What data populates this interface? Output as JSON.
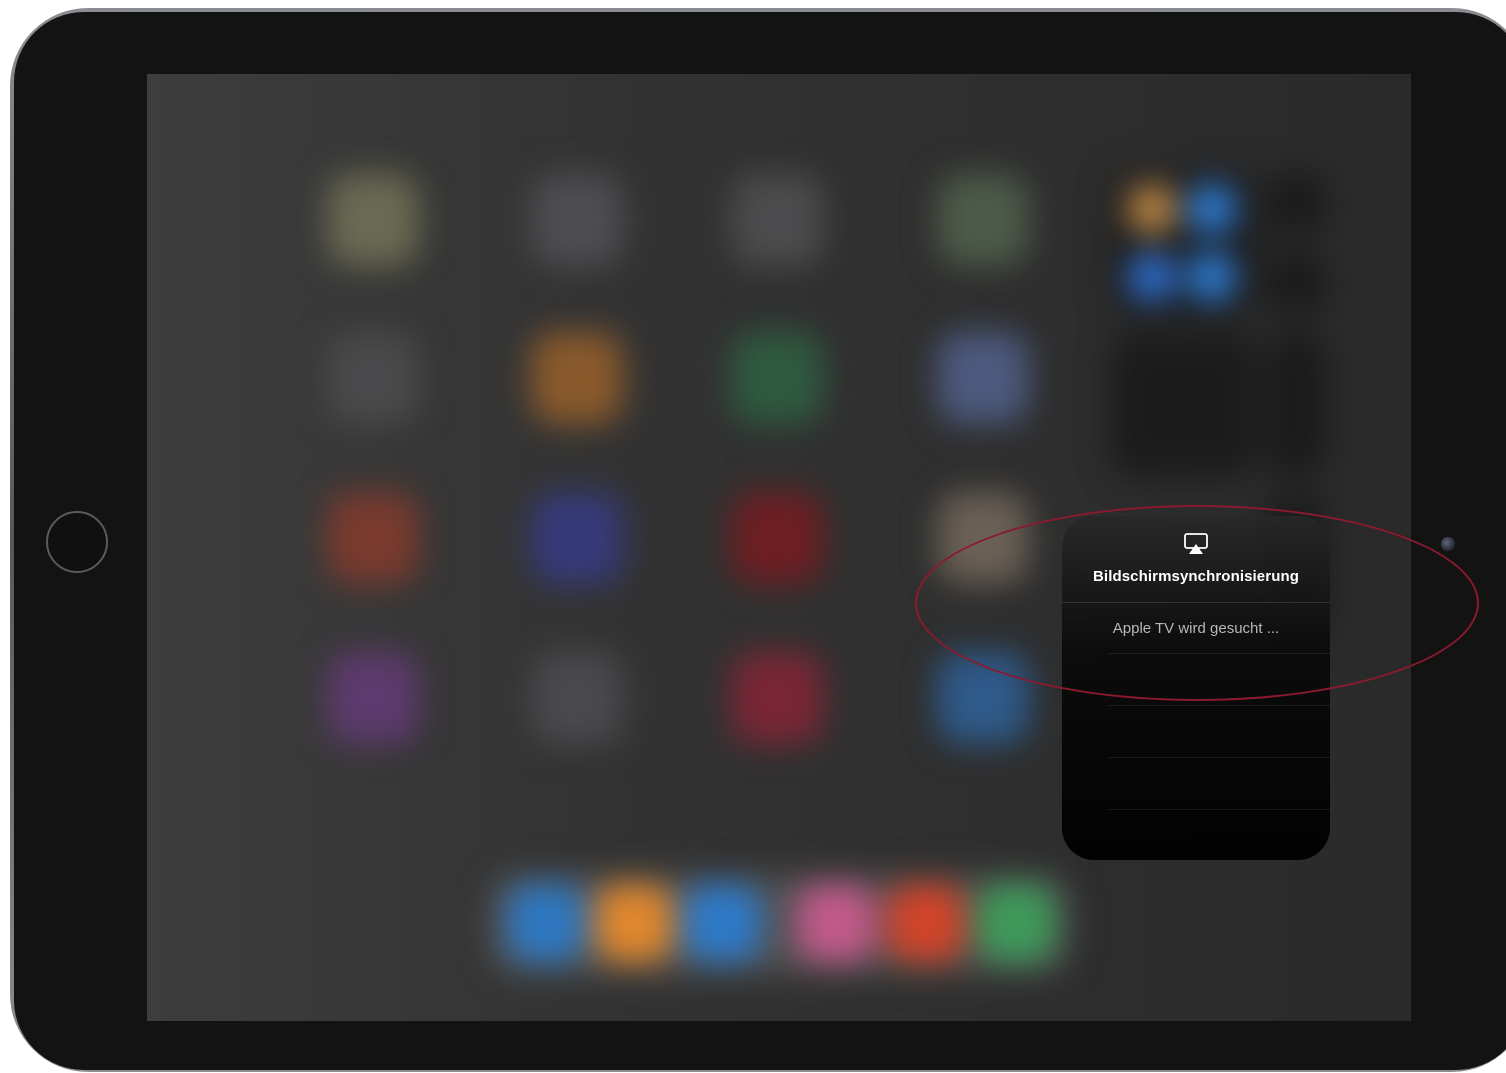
{
  "device": {
    "home_button_icon": "home-button",
    "camera_icon": "front-camera"
  },
  "home_screen": {
    "state": "blurred",
    "app_icon_colors": [
      "#6b6a52",
      "#4e4e52",
      "#4c4c4e",
      "#4d5b4a",
      "#4a4a4c",
      "#8a5a2c",
      "#2f5a40",
      "#4c5a7e",
      "#7a3a2e",
      "#363a7a",
      "#6e1e22",
      "#6a6056",
      "#5e3a6e",
      "#4a4a4e",
      "#7a2636",
      "#2e5a8a"
    ],
    "dock_icon_colors": [
      "#2e78c2",
      "#e0882e",
      "#2e7ac8",
      "#c25a8a",
      "#d2442a",
      "#3e9a5a"
    ]
  },
  "control_center": {
    "tile_dot_colors": [
      "#c08a48",
      "#2f7ed8",
      "#2f6fd0",
      "#2f7ed8"
    ]
  },
  "screen_mirroring": {
    "icon": "airplay-icon",
    "title": "Bildschirmsynchronisierung",
    "status": "Apple TV wird gesucht ..."
  },
  "annotation": {
    "color": "#8b1a2e"
  }
}
